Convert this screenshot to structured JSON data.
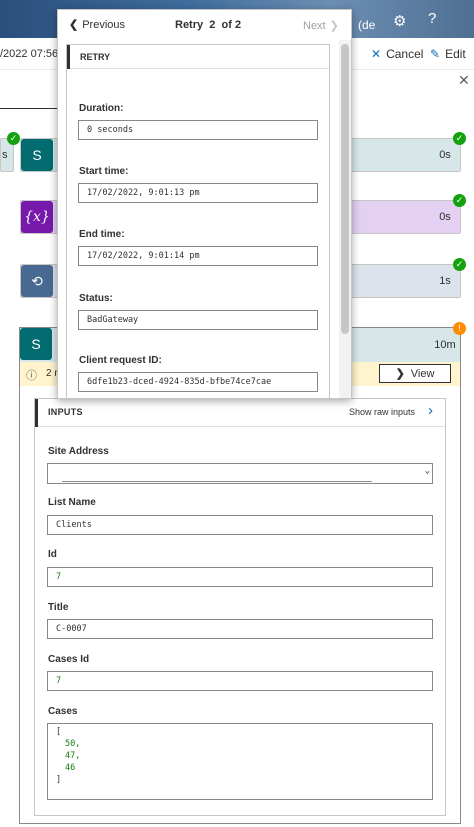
{
  "header": {
    "partial_title": "(de",
    "timestamp": "/2022 07:56:",
    "cancel_label": "Cancel",
    "edit_label": "Edit"
  },
  "flow": {
    "left_cut_label": "s",
    "step_durations": [
      "0s",
      "0s",
      "0s",
      "1s",
      "10m"
    ],
    "variable_icon_text": "{x}",
    "warning_text": "2 r",
    "view_label": "View"
  },
  "popover": {
    "previous_label": "Previous",
    "retry_word": "Retry",
    "retry_current": "2",
    "retry_of": "of 2",
    "next_label": "Next",
    "section_title": "RETRY",
    "fields": [
      {
        "label": "Duration:",
        "value": "0 seconds"
      },
      {
        "label": "Start time:",
        "value": "17/02/2022, 9:01:13 pm"
      },
      {
        "label": "End time:",
        "value": "17/02/2022, 9:01:14 pm"
      },
      {
        "label": "Status:",
        "value": "BadGateway"
      },
      {
        "label": "Client request ID:",
        "value": "6dfe1b23-dced-4924-835d-bfbe74ce7cae"
      }
    ]
  },
  "inputs": {
    "title": "INPUTS",
    "raw_label": "Show raw inputs",
    "site_address_label": "Site Address",
    "site_address_value": "",
    "list_name_label": "List Name",
    "list_name_value": "Clients",
    "id_label": "Id",
    "id_value": "7",
    "title_label": "Title",
    "title_value": "C-0007",
    "cases_id_label": "Cases Id",
    "cases_id_value": "7",
    "cases_label": "Cases",
    "cases_open": "[",
    "cases_values": [
      "50,",
      "47,",
      "46"
    ],
    "cases_close": "]"
  },
  "colors": {
    "accent": "#0f6cbd",
    "success": "#13a10e",
    "warning": "#ff8c00",
    "teal_card": "#d6e6e9",
    "purple_card": "#e3d0f3",
    "slate_card": "#dde3ec"
  }
}
